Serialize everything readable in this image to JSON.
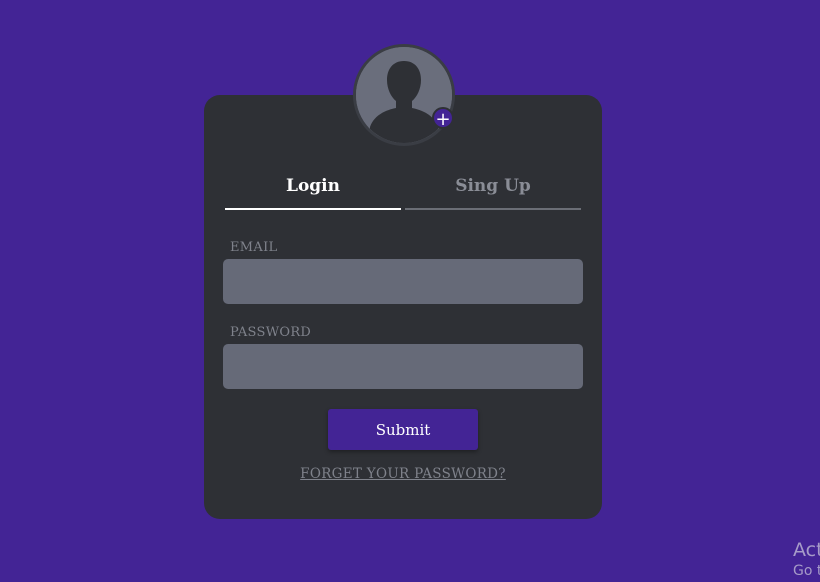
{
  "colors": {
    "background": "#432495",
    "card": "#2e3035",
    "input": "#666a78",
    "accent": "#432495"
  },
  "avatar": {
    "icon": "user-silhouette-icon",
    "add_icon": "plus-icon",
    "add_glyph": "+"
  },
  "tabs": [
    {
      "label": "Login",
      "active": true
    },
    {
      "label": "Sing Up",
      "active": false
    }
  ],
  "form": {
    "email_label": "EMAIL",
    "email_value": "",
    "password_label": "PASSWORD",
    "password_value": "",
    "submit_label": "Submit",
    "forgot_label": "FORGET YOUR PASSWORD?"
  },
  "watermark": {
    "line1": "Act",
    "line2": "Go t"
  }
}
